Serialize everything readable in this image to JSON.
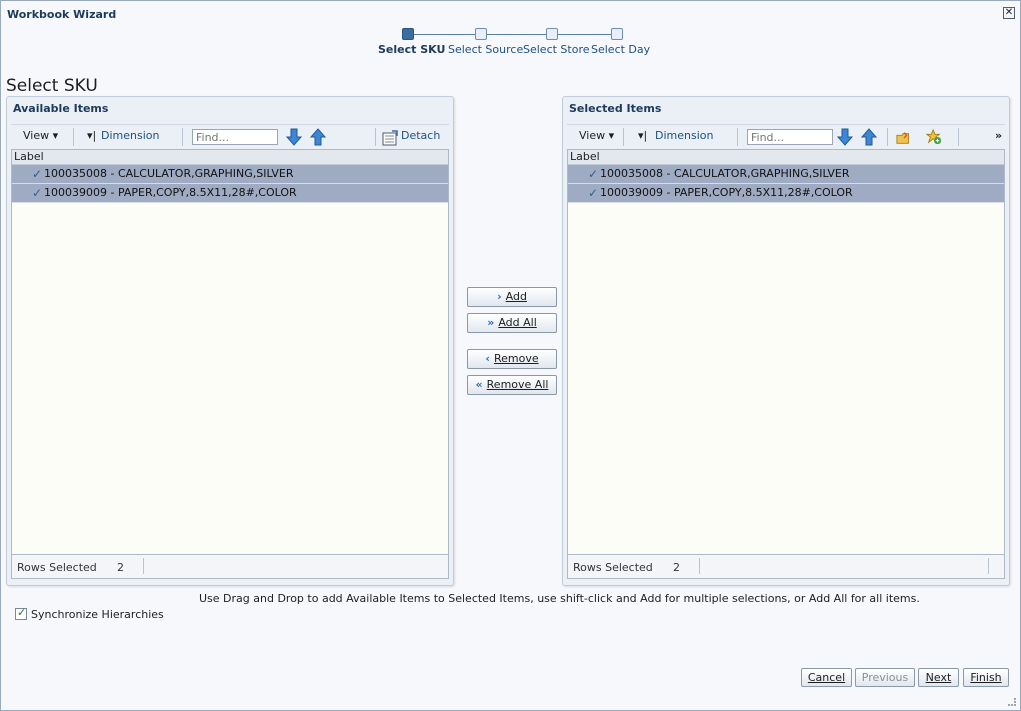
{
  "window": {
    "title": "Workbook Wizard",
    "close_icon": "✕"
  },
  "train": {
    "steps": [
      {
        "label": "Select SKU",
        "current": true
      },
      {
        "label": "Select Source",
        "current": false
      },
      {
        "label": "Select Store",
        "current": false
      },
      {
        "label": "Select Day",
        "current": false
      }
    ]
  },
  "page_heading": "Select SKU",
  "available": {
    "title": "Available Items",
    "toolbar": {
      "view": "View ▾",
      "dimension": "Dimension",
      "find_placeholder": "Find...",
      "detach": "Detach"
    },
    "column_header": "Label",
    "rows": [
      "100035008 - CALCULATOR,GRAPHING,SILVER",
      "100039009 - PAPER,COPY,8.5X11,28#,COLOR"
    ],
    "status": {
      "label": "Rows Selected",
      "count": "2"
    }
  },
  "selected": {
    "title": "Selected Items",
    "toolbar": {
      "view": "View ▾",
      "dimension": "Dimension",
      "find_placeholder": "Find...",
      "more": "»"
    },
    "column_header": "Label",
    "rows": [
      "100035008 - CALCULATOR,GRAPHING,SILVER",
      "100039009 - PAPER,COPY,8.5X11,28#,COLOR"
    ],
    "status": {
      "label": "Rows Selected",
      "count": "2"
    }
  },
  "shuttle": {
    "add": "Add",
    "add_all": "Add All",
    "remove": "Remove",
    "remove_all": "Remove All"
  },
  "hint": "Use Drag and Drop to add Available Items to Selected Items, use shift-click and Add for multiple selections, or Add All for all items.",
  "sync": {
    "label": "Synchronize Hierarchies",
    "checked": true
  },
  "footer": {
    "cancel": "Cancel",
    "previous": "Previous",
    "next": "Next",
    "finish": "Finish"
  },
  "icons": {
    "check": "✓",
    "down_arrow": "arrow-down-icon",
    "up_arrow": "arrow-up-icon",
    "detach": "detach-icon",
    "folder": "folder-icon",
    "favorite": "favorite-add-icon"
  },
  "colors": {
    "accent": "#1d4f84",
    "selected_row": "#9eabc2",
    "current_stop": "#3c6b9e"
  }
}
